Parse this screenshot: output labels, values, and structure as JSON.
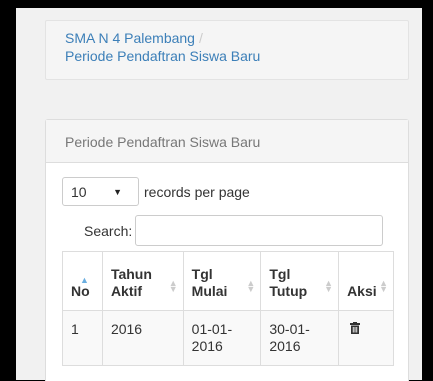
{
  "breadcrumb": {
    "items": [
      "SMA N 4 Palembang",
      "Periode Pendaftran Siswa Baru"
    ],
    "separator": "/"
  },
  "panel": {
    "title": "Periode Pendaftran Siswa Baru"
  },
  "datatable": {
    "length_value": "10",
    "length_label": "records per page",
    "search_label": "Search:",
    "search_value": "",
    "columns": [
      {
        "line1": "No",
        "line2": ""
      },
      {
        "line1": "Tahun",
        "line2": "Aktif"
      },
      {
        "line1": "Tgl",
        "line2": "Mulai"
      },
      {
        "line1": "Tgl",
        "line2": "Tutup"
      },
      {
        "line1": "Aksi",
        "line2": ""
      }
    ],
    "rows": [
      {
        "no": "1",
        "tahun": "2016",
        "mulai_1": "01-01-",
        "mulai_2": "2016",
        "tutup_1": "30-01-",
        "tutup_2": "2016",
        "action_icon": "trash-icon"
      }
    ]
  },
  "colors": {
    "link": "#3c7fb8",
    "sort_active": "#5ab0e0"
  }
}
